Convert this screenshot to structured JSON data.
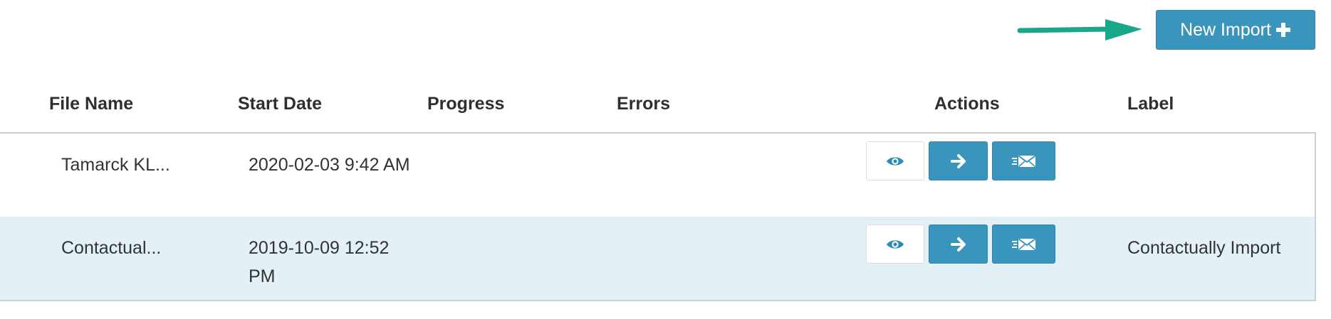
{
  "toolbar": {
    "new_import_label": "New Import",
    "plus_icon": "plus-icon",
    "annotation_arrow_color": "#1aa88b",
    "button_color": "#3a95bd"
  },
  "table": {
    "headers": {
      "file_name": "File Name",
      "start_date": "Start Date",
      "progress": "Progress",
      "errors": "Errors",
      "actions": "Actions",
      "label": "Label"
    },
    "rows": [
      {
        "file_name": "Tamarck KL...",
        "start_date": "2020-02-03 9:42 AM",
        "progress": "",
        "errors": "",
        "label": "",
        "actions": [
          "eye-icon",
          "arrow-right-icon",
          "send-mail-icon"
        ]
      },
      {
        "file_name": "Contactual...",
        "start_date": "2019-10-09 12:52 PM",
        "progress": "",
        "errors": "",
        "label": "Contactually Import",
        "actions": [
          "eye-icon",
          "arrow-right-icon",
          "send-mail-icon"
        ]
      }
    ],
    "alt_row_color": "#e3f1f7"
  }
}
